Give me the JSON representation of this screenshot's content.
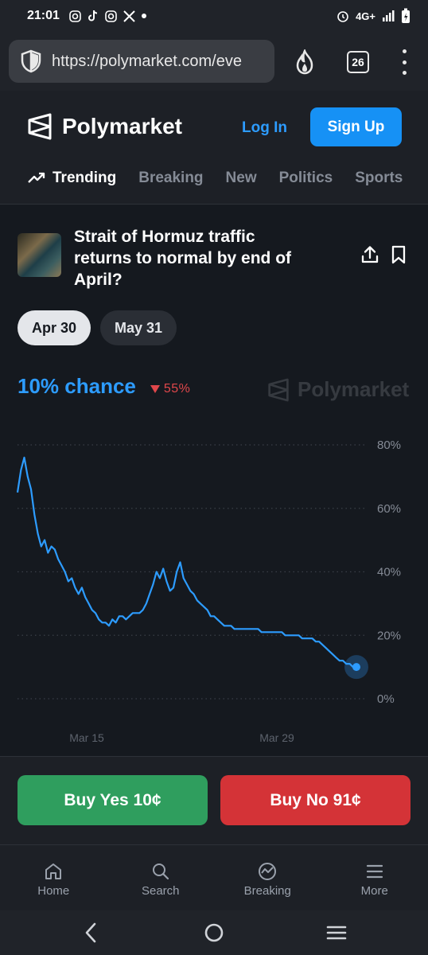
{
  "status_bar": {
    "time": "21:01",
    "notification_icons": [
      "instagram-icon",
      "tiktok-icon",
      "instagram-icon",
      "x-icon",
      "dot-icon"
    ],
    "network": "4G+",
    "icons": [
      "alarm-icon",
      "signal-icon",
      "battery-charging-icon"
    ]
  },
  "browser": {
    "url": "https://polymarket.com/eve",
    "tab_count": "26"
  },
  "header": {
    "brand": "Polymarket",
    "login_label": "Log In",
    "signup_label": "Sign Up",
    "nav": [
      "Trending",
      "Breaking",
      "New",
      "Politics",
      "Sports"
    ]
  },
  "market": {
    "title": "Strait of Hormuz traffic returns to normal by end of April?",
    "date_options": [
      "Apr 30",
      "May 31"
    ],
    "selected_date": "Apr 30",
    "chance": "10% chance",
    "change": "55%",
    "watermark": "Polymarket"
  },
  "chart_data": {
    "type": "line",
    "series": [
      {
        "color": "#2d9cff",
        "x": [
          0,
          1,
          2,
          3,
          4,
          5,
          6,
          7,
          8,
          9,
          10,
          11,
          12,
          13,
          14,
          15,
          16,
          17,
          18,
          19,
          20,
          21,
          22,
          23,
          24,
          25,
          26,
          27,
          28,
          29,
          30,
          31,
          32,
          33,
          34,
          35,
          36,
          37,
          38,
          39,
          40,
          41,
          42,
          43,
          44,
          45,
          46,
          47,
          48,
          49,
          50,
          51,
          52,
          53,
          54,
          55,
          56,
          57,
          58,
          59,
          60,
          61,
          62,
          63,
          64,
          65,
          66,
          67,
          68,
          69,
          70,
          71,
          72,
          73,
          74,
          75,
          76,
          77,
          78,
          79,
          80,
          81,
          82,
          83,
          84,
          85,
          86,
          87,
          88,
          89,
          90,
          91,
          92,
          93,
          94,
          95,
          96,
          97,
          98,
          99,
          100
        ],
        "values": [
          65,
          72,
          76,
          70,
          66,
          58,
          52,
          48,
          50,
          46,
          48,
          47,
          44,
          42,
          40,
          37,
          38,
          35,
          33,
          35,
          32,
          30,
          28,
          27,
          25,
          24,
          24,
          23,
          25,
          24,
          26,
          26,
          25,
          26,
          27,
          27,
          27,
          28,
          30,
          33,
          36,
          40,
          38,
          41,
          37,
          34,
          35,
          40,
          43,
          38,
          36,
          34,
          33,
          31,
          30,
          29,
          28,
          26,
          26,
          25,
          24,
          23,
          23,
          23,
          22,
          22,
          22,
          22,
          22,
          22,
          22,
          22,
          21,
          21,
          21,
          21,
          21,
          21,
          21,
          20,
          20,
          20,
          20,
          20,
          19,
          19,
          19,
          19,
          18,
          18,
          17,
          16,
          15,
          14,
          13,
          12,
          12,
          11,
          11,
          10,
          10
        ],
        "current": 10
      }
    ],
    "y_ticks": [
      "0%",
      "20%",
      "40%",
      "60%",
      "80%"
    ],
    "ylim": [
      0,
      80
    ],
    "x_ticks": [
      "Mar 15",
      "Mar 29"
    ],
    "grid": true,
    "grid_style": "dotted"
  },
  "actions": {
    "buy_yes": "Buy Yes 10¢",
    "buy_no": "Buy No 91¢"
  },
  "bottom_nav": [
    {
      "label": "Home",
      "icon": "home-icon"
    },
    {
      "label": "Search",
      "icon": "search-icon"
    },
    {
      "label": "Breaking",
      "icon": "breaking-icon"
    },
    {
      "label": "More",
      "icon": "menu-icon"
    }
  ]
}
